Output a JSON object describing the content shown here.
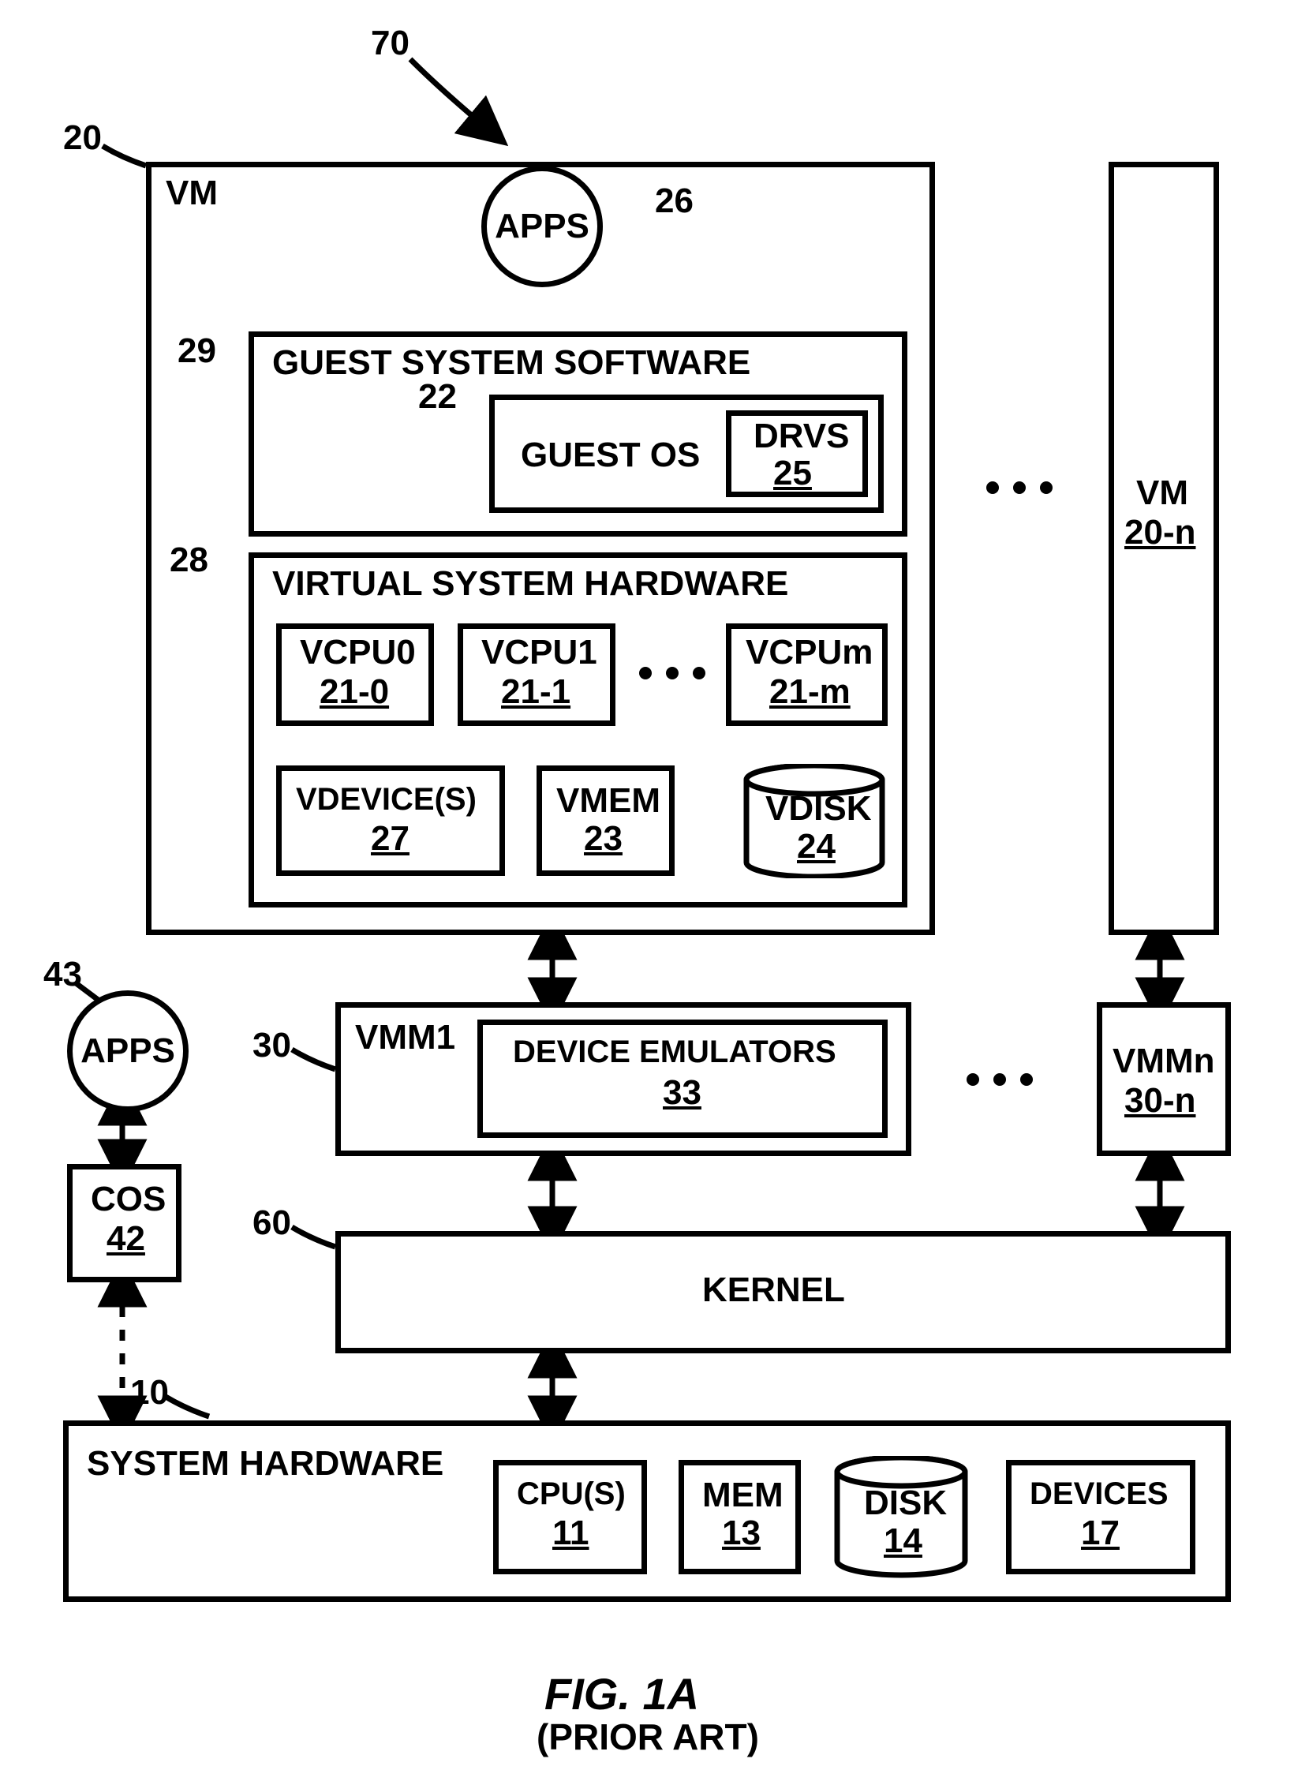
{
  "figure": {
    "title": "FIG. 1A",
    "subtitle": "(PRIOR ART)"
  },
  "refs": {
    "system": "70",
    "vm": "20",
    "apps_vm": "26",
    "gss": "29",
    "guestos": "22",
    "drvs": "25",
    "vsh": "28",
    "vmn": "20-n",
    "vcpu0": "21-0",
    "vcpu1": "21-1",
    "vcpum": "21-m",
    "vdevices": "27",
    "vmem": "23",
    "vdisk": "24",
    "apps_cos": "43",
    "vmm1": "30",
    "device_emulators": "33",
    "vmmn": "30-n",
    "cos": "42",
    "kernel": "60",
    "syshw": "10",
    "cpus": "11",
    "mem": "13",
    "disk": "14",
    "devices": "17"
  },
  "labels": {
    "vm": "VM",
    "apps": "APPS",
    "gss": "GUEST SYSTEM SOFTWARE",
    "guestos": "GUEST OS",
    "drvs": "DRVS",
    "vsh": "VIRTUAL SYSTEM HARDWARE",
    "vcpu0": "VCPU0",
    "vcpu1": "VCPU1",
    "vcpum": "VCPUm",
    "vdevices": "VDEVICE(S)",
    "vmem": "VMEM",
    "vdisk": "VDISK",
    "vmn": "VM",
    "vmm1": "VMM1",
    "device_emulators": "DEVICE EMULATORS",
    "vmmn": "VMMn",
    "cos": "COS",
    "kernel": "KERNEL",
    "syshw": "SYSTEM HARDWARE",
    "cpus": "CPU(S)",
    "mem": "MEM",
    "disk": "DISK",
    "devices": "DEVICES"
  }
}
